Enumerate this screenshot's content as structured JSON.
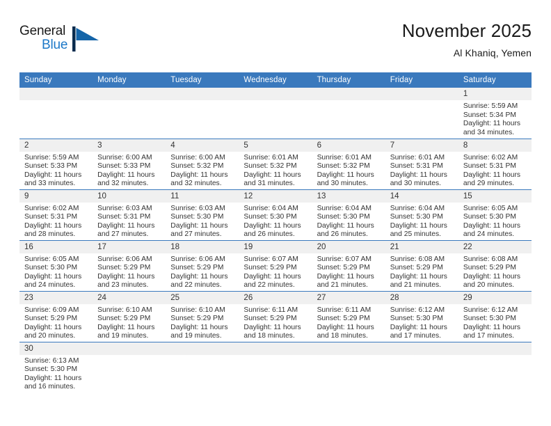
{
  "brand": {
    "name_part1": "General",
    "name_part2": "Blue",
    "logo_icon": "blue-triangle-flag-icon",
    "accent_color": "#1c78c8"
  },
  "header": {
    "title": "November 2025",
    "location": "Al Khaniq, Yemen"
  },
  "theme": {
    "header_blue": "#3a79bd",
    "daynum_band": "#f0f0f0",
    "text": "#333333"
  },
  "weekday_headers": [
    "Sunday",
    "Monday",
    "Tuesday",
    "Wednesday",
    "Thursday",
    "Friday",
    "Saturday"
  ],
  "labels": {
    "sunrise_prefix": "Sunrise:",
    "sunset_prefix": "Sunset:",
    "daylight_prefix": "Daylight:"
  },
  "weeks": [
    [
      {
        "day": "",
        "empty": true
      },
      {
        "day": "",
        "empty": true
      },
      {
        "day": "",
        "empty": true
      },
      {
        "day": "",
        "empty": true
      },
      {
        "day": "",
        "empty": true
      },
      {
        "day": "",
        "empty": true
      },
      {
        "day": "1",
        "sunrise": "Sunrise: 5:59 AM",
        "sunset": "Sunset: 5:34 PM",
        "daylight_line1": "Daylight: 11 hours",
        "daylight_line2": "and 34 minutes."
      }
    ],
    [
      {
        "day": "2",
        "sunrise": "Sunrise: 5:59 AM",
        "sunset": "Sunset: 5:33 PM",
        "daylight_line1": "Daylight: 11 hours",
        "daylight_line2": "and 33 minutes."
      },
      {
        "day": "3",
        "sunrise": "Sunrise: 6:00 AM",
        "sunset": "Sunset: 5:33 PM",
        "daylight_line1": "Daylight: 11 hours",
        "daylight_line2": "and 32 minutes."
      },
      {
        "day": "4",
        "sunrise": "Sunrise: 6:00 AM",
        "sunset": "Sunset: 5:32 PM",
        "daylight_line1": "Daylight: 11 hours",
        "daylight_line2": "and 32 minutes."
      },
      {
        "day": "5",
        "sunrise": "Sunrise: 6:01 AM",
        "sunset": "Sunset: 5:32 PM",
        "daylight_line1": "Daylight: 11 hours",
        "daylight_line2": "and 31 minutes."
      },
      {
        "day": "6",
        "sunrise": "Sunrise: 6:01 AM",
        "sunset": "Sunset: 5:32 PM",
        "daylight_line1": "Daylight: 11 hours",
        "daylight_line2": "and 30 minutes."
      },
      {
        "day": "7",
        "sunrise": "Sunrise: 6:01 AM",
        "sunset": "Sunset: 5:31 PM",
        "daylight_line1": "Daylight: 11 hours",
        "daylight_line2": "and 30 minutes."
      },
      {
        "day": "8",
        "sunrise": "Sunrise: 6:02 AM",
        "sunset": "Sunset: 5:31 PM",
        "daylight_line1": "Daylight: 11 hours",
        "daylight_line2": "and 29 minutes."
      }
    ],
    [
      {
        "day": "9",
        "sunrise": "Sunrise: 6:02 AM",
        "sunset": "Sunset: 5:31 PM",
        "daylight_line1": "Daylight: 11 hours",
        "daylight_line2": "and 28 minutes."
      },
      {
        "day": "10",
        "sunrise": "Sunrise: 6:03 AM",
        "sunset": "Sunset: 5:31 PM",
        "daylight_line1": "Daylight: 11 hours",
        "daylight_line2": "and 27 minutes."
      },
      {
        "day": "11",
        "sunrise": "Sunrise: 6:03 AM",
        "sunset": "Sunset: 5:30 PM",
        "daylight_line1": "Daylight: 11 hours",
        "daylight_line2": "and 27 minutes."
      },
      {
        "day": "12",
        "sunrise": "Sunrise: 6:04 AM",
        "sunset": "Sunset: 5:30 PM",
        "daylight_line1": "Daylight: 11 hours",
        "daylight_line2": "and 26 minutes."
      },
      {
        "day": "13",
        "sunrise": "Sunrise: 6:04 AM",
        "sunset": "Sunset: 5:30 PM",
        "daylight_line1": "Daylight: 11 hours",
        "daylight_line2": "and 26 minutes."
      },
      {
        "day": "14",
        "sunrise": "Sunrise: 6:04 AM",
        "sunset": "Sunset: 5:30 PM",
        "daylight_line1": "Daylight: 11 hours",
        "daylight_line2": "and 25 minutes."
      },
      {
        "day": "15",
        "sunrise": "Sunrise: 6:05 AM",
        "sunset": "Sunset: 5:30 PM",
        "daylight_line1": "Daylight: 11 hours",
        "daylight_line2": "and 24 minutes."
      }
    ],
    [
      {
        "day": "16",
        "sunrise": "Sunrise: 6:05 AM",
        "sunset": "Sunset: 5:30 PM",
        "daylight_line1": "Daylight: 11 hours",
        "daylight_line2": "and 24 minutes."
      },
      {
        "day": "17",
        "sunrise": "Sunrise: 6:06 AM",
        "sunset": "Sunset: 5:29 PM",
        "daylight_line1": "Daylight: 11 hours",
        "daylight_line2": "and 23 minutes."
      },
      {
        "day": "18",
        "sunrise": "Sunrise: 6:06 AM",
        "sunset": "Sunset: 5:29 PM",
        "daylight_line1": "Daylight: 11 hours",
        "daylight_line2": "and 22 minutes."
      },
      {
        "day": "19",
        "sunrise": "Sunrise: 6:07 AM",
        "sunset": "Sunset: 5:29 PM",
        "daylight_line1": "Daylight: 11 hours",
        "daylight_line2": "and 22 minutes."
      },
      {
        "day": "20",
        "sunrise": "Sunrise: 6:07 AM",
        "sunset": "Sunset: 5:29 PM",
        "daylight_line1": "Daylight: 11 hours",
        "daylight_line2": "and 21 minutes."
      },
      {
        "day": "21",
        "sunrise": "Sunrise: 6:08 AM",
        "sunset": "Sunset: 5:29 PM",
        "daylight_line1": "Daylight: 11 hours",
        "daylight_line2": "and 21 minutes."
      },
      {
        "day": "22",
        "sunrise": "Sunrise: 6:08 AM",
        "sunset": "Sunset: 5:29 PM",
        "daylight_line1": "Daylight: 11 hours",
        "daylight_line2": "and 20 minutes."
      }
    ],
    [
      {
        "day": "23",
        "sunrise": "Sunrise: 6:09 AM",
        "sunset": "Sunset: 5:29 PM",
        "daylight_line1": "Daylight: 11 hours",
        "daylight_line2": "and 20 minutes."
      },
      {
        "day": "24",
        "sunrise": "Sunrise: 6:10 AM",
        "sunset": "Sunset: 5:29 PM",
        "daylight_line1": "Daylight: 11 hours",
        "daylight_line2": "and 19 minutes."
      },
      {
        "day": "25",
        "sunrise": "Sunrise: 6:10 AM",
        "sunset": "Sunset: 5:29 PM",
        "daylight_line1": "Daylight: 11 hours",
        "daylight_line2": "and 19 minutes."
      },
      {
        "day": "26",
        "sunrise": "Sunrise: 6:11 AM",
        "sunset": "Sunset: 5:29 PM",
        "daylight_line1": "Daylight: 11 hours",
        "daylight_line2": "and 18 minutes."
      },
      {
        "day": "27",
        "sunrise": "Sunrise: 6:11 AM",
        "sunset": "Sunset: 5:29 PM",
        "daylight_line1": "Daylight: 11 hours",
        "daylight_line2": "and 18 minutes."
      },
      {
        "day": "28",
        "sunrise": "Sunrise: 6:12 AM",
        "sunset": "Sunset: 5:30 PM",
        "daylight_line1": "Daylight: 11 hours",
        "daylight_line2": "and 17 minutes."
      },
      {
        "day": "29",
        "sunrise": "Sunrise: 6:12 AM",
        "sunset": "Sunset: 5:30 PM",
        "daylight_line1": "Daylight: 11 hours",
        "daylight_line2": "and 17 minutes."
      }
    ],
    [
      {
        "day": "30",
        "sunrise": "Sunrise: 6:13 AM",
        "sunset": "Sunset: 5:30 PM",
        "daylight_line1": "Daylight: 11 hours",
        "daylight_line2": "and 16 minutes."
      },
      {
        "day": "",
        "empty": true
      },
      {
        "day": "",
        "empty": true
      },
      {
        "day": "",
        "empty": true
      },
      {
        "day": "",
        "empty": true
      },
      {
        "day": "",
        "empty": true
      },
      {
        "day": "",
        "empty": true
      }
    ]
  ]
}
